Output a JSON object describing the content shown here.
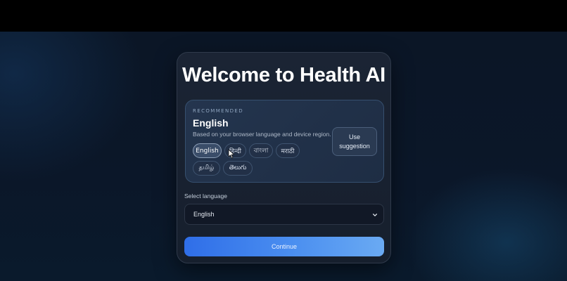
{
  "page": {
    "title": "Welcome to Health AI"
  },
  "recommended": {
    "kicker": "RECOMMENDED",
    "language": "English",
    "description": "Based on your browser language and device region.",
    "use_button": "Use suggestion",
    "chips": [
      {
        "label": "English",
        "active": true
      },
      {
        "label": "हिन्दी",
        "active": false
      },
      {
        "label": "বাংলা",
        "active": false
      },
      {
        "label": "मराठी",
        "active": false
      },
      {
        "label": "தமிழ்",
        "active": false
      },
      {
        "label": "తెలుగు",
        "active": false
      }
    ]
  },
  "select": {
    "label": "Select language",
    "value": "English"
  },
  "continue_label": "Continue",
  "colors": {
    "accent_start": "#2f6ee8",
    "accent_end": "#6aaaf3"
  },
  "icons": {
    "select_chevron": "chevron-down-icon",
    "cursor": "pointer-cursor-icon"
  }
}
